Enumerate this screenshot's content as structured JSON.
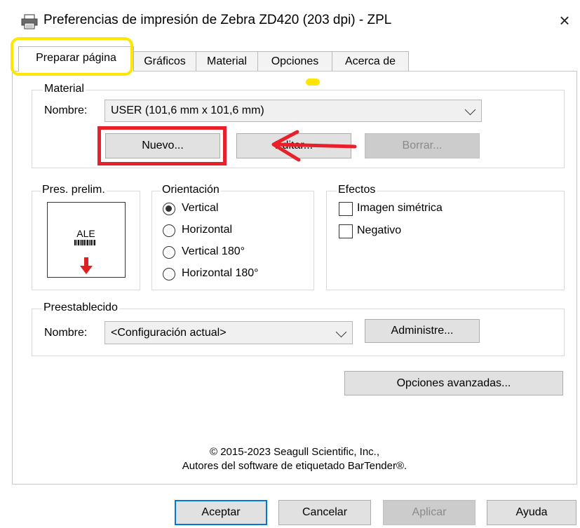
{
  "window": {
    "title": "Preferencias de impresión de Zebra ZD420 (203 dpi) - ZPL",
    "close_symbol": "×",
    "icon": "printer-icon"
  },
  "tabs": [
    {
      "label": "Preparar página",
      "active": true
    },
    {
      "label": "Gráficos",
      "active": false
    },
    {
      "label": "Material",
      "active": false
    },
    {
      "label": "Opciones",
      "active": false
    },
    {
      "label": "Acerca de",
      "active": false
    }
  ],
  "material": {
    "group_label": "Material",
    "name_label": "Nombre:",
    "name_value": "USER (101,6 mm x 101,6 mm)",
    "new_button": "Nuevo...",
    "edit_button": "Editar...",
    "delete_button": "Borrar..."
  },
  "preview": {
    "group_label": "Pres. prelim.",
    "sample_text": "ALE"
  },
  "orientation": {
    "group_label": "Orientación",
    "options": [
      {
        "label": "Vertical",
        "checked": true
      },
      {
        "label": "Horizontal",
        "checked": false
      },
      {
        "label": "Vertical 180°",
        "checked": false
      },
      {
        "label": "Horizontal 180°",
        "checked": false
      }
    ]
  },
  "effects": {
    "group_label": "Efectos",
    "options": [
      {
        "label": "Imagen simétrica",
        "checked": false
      },
      {
        "label": "Negativo",
        "checked": false
      }
    ]
  },
  "preset": {
    "group_label": "Preestablecido",
    "name_label": "Nombre:",
    "name_value": "<Configuración actual>",
    "manage_button": "Administre..."
  },
  "advanced_button": "Opciones avanzadas...",
  "copyright": {
    "line1": "© 2015-2023 Seagull Scientific, Inc.,",
    "line2": "Autores del software de etiquetado BarTender®."
  },
  "footer": {
    "ok": "Aceptar",
    "cancel": "Cancelar",
    "apply": "Aplicar",
    "help": "Ayuda"
  },
  "colors": {
    "highlight_yellow": "#ffe600",
    "highlight_red": "#e8202a",
    "default_button_border": "#0078d7"
  }
}
